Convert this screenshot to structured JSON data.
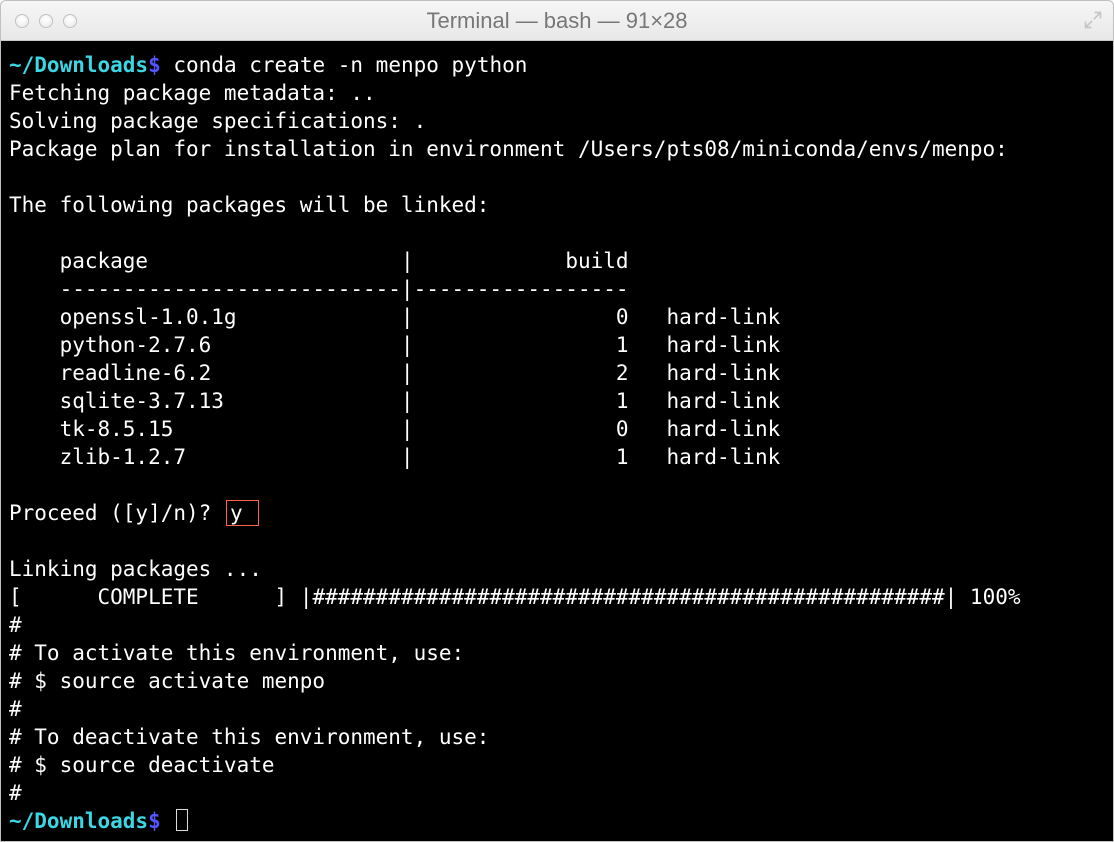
{
  "window": {
    "title": "Terminal — bash — 91×28"
  },
  "prompt": {
    "path": "~/Downloads",
    "symbol": "$"
  },
  "command": "conda create -n menpo python",
  "output": {
    "fetching": "Fetching package metadata: ..",
    "solving": "Solving package specifications: .",
    "plan": "Package plan for installation in environment /Users/pts08/miniconda/envs/menpo:",
    "linked_heading": "The following packages will be linked:",
    "table_header_package": "package",
    "table_header_build": "build",
    "divider": "    ---------------------------|-----------------",
    "packages": [
      {
        "name": "openssl-1.0.1g",
        "build": "0",
        "type": "hard-link"
      },
      {
        "name": "python-2.7.6",
        "build": "1",
        "type": "hard-link"
      },
      {
        "name": "readline-6.2",
        "build": "2",
        "type": "hard-link"
      },
      {
        "name": "sqlite-3.7.13",
        "build": "1",
        "type": "hard-link"
      },
      {
        "name": "tk-8.5.15",
        "build": "0",
        "type": "hard-link"
      },
      {
        "name": "zlib-1.2.7",
        "build": "1",
        "type": "hard-link"
      }
    ],
    "proceed_prompt": "Proceed ([y]/n)?",
    "proceed_answer": "y",
    "linking": "Linking packages ...",
    "progress_left": "[      COMPLETE      ]",
    "progress_bar": "|##################################################|",
    "progress_pct": "100%",
    "instructions": [
      "#",
      "# To activate this environment, use:",
      "# $ source activate menpo",
      "#",
      "# To deactivate this environment, use:",
      "# $ source deactivate",
      "#"
    ]
  }
}
